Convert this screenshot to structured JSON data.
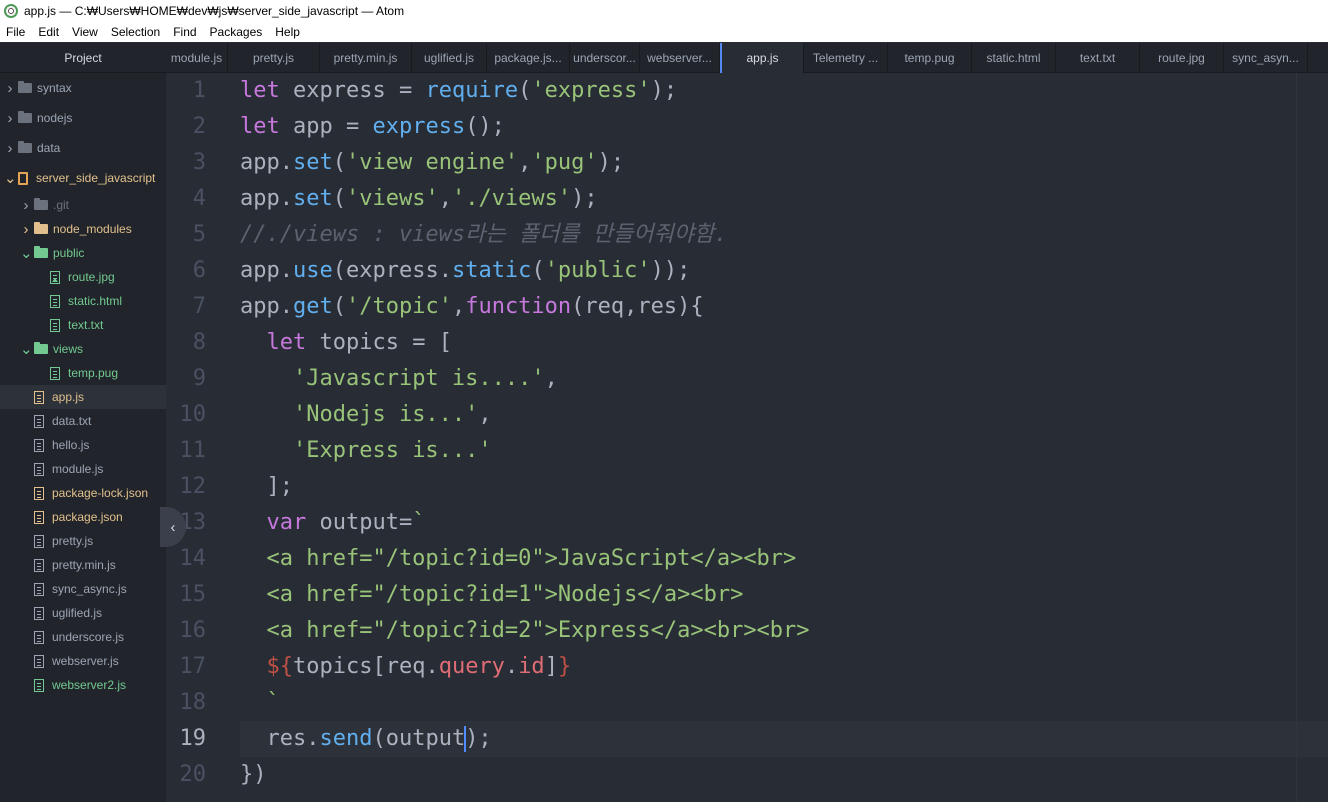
{
  "window": {
    "title": "app.js — C:₩Users₩HOME₩dev₩js₩server_side_javascript — Atom"
  },
  "menu": [
    "File",
    "Edit",
    "View",
    "Selection",
    "Find",
    "Packages",
    "Help"
  ],
  "sidebar": {
    "header": "Project",
    "items": [
      {
        "label": "syntax",
        "kind": "folder",
        "state": "collapsed",
        "depth": 0,
        "color": "gray"
      },
      {
        "label": "nodejs",
        "kind": "folder",
        "state": "collapsed",
        "depth": 0,
        "color": "gray"
      },
      {
        "label": "data",
        "kind": "folder",
        "state": "collapsed",
        "depth": 0,
        "color": "gray"
      },
      {
        "label": "server_side_javascript",
        "kind": "repo",
        "state": "expanded",
        "depth": 0,
        "color": "orange"
      },
      {
        "label": ".git",
        "kind": "folder",
        "state": "collapsed",
        "depth": 1,
        "color": "dim"
      },
      {
        "label": "node_modules",
        "kind": "folder",
        "state": "collapsed",
        "depth": 1,
        "color": "orange"
      },
      {
        "label": "public",
        "kind": "folder",
        "state": "expanded",
        "depth": 1,
        "color": "green"
      },
      {
        "label": "route.jpg",
        "kind": "image",
        "depth": 2,
        "color": "green"
      },
      {
        "label": "static.html",
        "kind": "file",
        "depth": 2,
        "color": "green"
      },
      {
        "label": "text.txt",
        "kind": "file",
        "depth": 2,
        "color": "green"
      },
      {
        "label": "views",
        "kind": "folder",
        "state": "expanded",
        "depth": 1,
        "color": "green"
      },
      {
        "label": "temp.pug",
        "kind": "file",
        "depth": 2,
        "color": "green"
      },
      {
        "label": "app.js",
        "kind": "file",
        "depth": 1,
        "color": "orange",
        "selected": true
      },
      {
        "label": "data.txt",
        "kind": "file",
        "depth": 1,
        "color": "gray"
      },
      {
        "label": "hello.js",
        "kind": "file",
        "depth": 1,
        "color": "gray"
      },
      {
        "label": "module.js",
        "kind": "file",
        "depth": 1,
        "color": "gray"
      },
      {
        "label": "package-lock.json",
        "kind": "file",
        "depth": 1,
        "color": "orange"
      },
      {
        "label": "package.json",
        "kind": "file",
        "depth": 1,
        "color": "orange"
      },
      {
        "label": "pretty.js",
        "kind": "file",
        "depth": 1,
        "color": "gray"
      },
      {
        "label": "pretty.min.js",
        "kind": "file",
        "depth": 1,
        "color": "gray"
      },
      {
        "label": "sync_async.js",
        "kind": "file",
        "depth": 1,
        "color": "gray"
      },
      {
        "label": "uglified.js",
        "kind": "file",
        "depth": 1,
        "color": "gray"
      },
      {
        "label": "underscore.js",
        "kind": "file",
        "depth": 1,
        "color": "gray"
      },
      {
        "label": "webserver.js",
        "kind": "file",
        "depth": 1,
        "color": "gray"
      },
      {
        "label": "webserver2.js",
        "kind": "file",
        "depth": 1,
        "color": "green"
      }
    ]
  },
  "tabs": [
    {
      "label": "module.js"
    },
    {
      "label": "pretty.js"
    },
    {
      "label": "pretty.min.js"
    },
    {
      "label": "uglified.js"
    },
    {
      "label": "package.js..."
    },
    {
      "label": "underscor..."
    },
    {
      "label": "webserver..."
    },
    {
      "label": "app.js",
      "active": true
    },
    {
      "label": "Telemetry ..."
    },
    {
      "label": "temp.pug"
    },
    {
      "label": "static.html"
    },
    {
      "label": "text.txt"
    },
    {
      "label": "route.jpg"
    },
    {
      "label": "sync_asyn..."
    }
  ],
  "editor": {
    "cursor_line": 19,
    "lines": [
      [
        [
          "k",
          "let"
        ],
        [
          "p",
          " express = "
        ],
        [
          "f",
          "require"
        ],
        [
          "p",
          "("
        ],
        [
          "s",
          "'express'"
        ],
        [
          "p",
          ");"
        ]
      ],
      [
        [
          "k",
          "let"
        ],
        [
          "p",
          " app = "
        ],
        [
          "f",
          "express"
        ],
        [
          "p",
          "();"
        ]
      ],
      [
        [
          "p",
          "app."
        ],
        [
          "f",
          "set"
        ],
        [
          "p",
          "("
        ],
        [
          "s",
          "'view engine'"
        ],
        [
          "p",
          ","
        ],
        [
          "s",
          "'pug'"
        ],
        [
          "p",
          ");"
        ]
      ],
      [
        [
          "p",
          "app."
        ],
        [
          "f",
          "set"
        ],
        [
          "p",
          "("
        ],
        [
          "s",
          "'views'"
        ],
        [
          "p",
          ","
        ],
        [
          "s",
          "'./views'"
        ],
        [
          "p",
          ");"
        ]
      ],
      [
        [
          "c",
          "//./views : views라는 폴더를 만들어줘야함."
        ]
      ],
      [
        [
          "p",
          "app."
        ],
        [
          "f",
          "use"
        ],
        [
          "p",
          "(express."
        ],
        [
          "f",
          "static"
        ],
        [
          "p",
          "("
        ],
        [
          "s",
          "'public'"
        ],
        [
          "p",
          "));"
        ]
      ],
      [
        [
          "p",
          "app."
        ],
        [
          "f",
          "get"
        ],
        [
          "p",
          "("
        ],
        [
          "s",
          "'/topic'"
        ],
        [
          "p",
          ","
        ],
        [
          "k",
          "function"
        ],
        [
          "p",
          "(req,res){"
        ]
      ],
      [
        [
          "p",
          "  "
        ],
        [
          "k",
          "let"
        ],
        [
          "p",
          " topics = ["
        ]
      ],
      [
        [
          "p",
          "    "
        ],
        [
          "s",
          "'Javascript is....'"
        ],
        [
          "p",
          ","
        ]
      ],
      [
        [
          "p",
          "    "
        ],
        [
          "s",
          "'Nodejs is...'"
        ],
        [
          "p",
          ","
        ]
      ],
      [
        [
          "p",
          "    "
        ],
        [
          "s",
          "'Express is...'"
        ]
      ],
      [
        [
          "p",
          "  ];"
        ]
      ],
      [
        [
          "p",
          "  "
        ],
        [
          "k",
          "var"
        ],
        [
          "p",
          " output="
        ],
        [
          "s",
          "`"
        ]
      ],
      [
        [
          "s",
          "  <a href=\"/topic?id=0\">JavaScript</a><br>"
        ]
      ],
      [
        [
          "s",
          "  <a href=\"/topic?id=1\">Nodejs</a><br>"
        ]
      ],
      [
        [
          "s",
          "  <a href=\"/topic?id=2\">Express</a><br><br>"
        ]
      ],
      [
        [
          "p",
          "  "
        ],
        [
          "i",
          "${"
        ],
        [
          "p",
          "topics[req."
        ],
        [
          "v",
          "query"
        ],
        [
          "p",
          "."
        ],
        [
          "v",
          "id"
        ],
        [
          "p",
          "]"
        ],
        [
          "i",
          "}"
        ]
      ],
      [
        [
          "s",
          "  `"
        ]
      ],
      [
        [
          "p",
          "  res."
        ],
        [
          "f",
          "send"
        ],
        [
          "p",
          "(output"
        ],
        [
          "caret",
          ""
        ],
        [
          "p",
          ");"
        ]
      ],
      [
        [
          "p",
          "})"
        ]
      ]
    ]
  }
}
